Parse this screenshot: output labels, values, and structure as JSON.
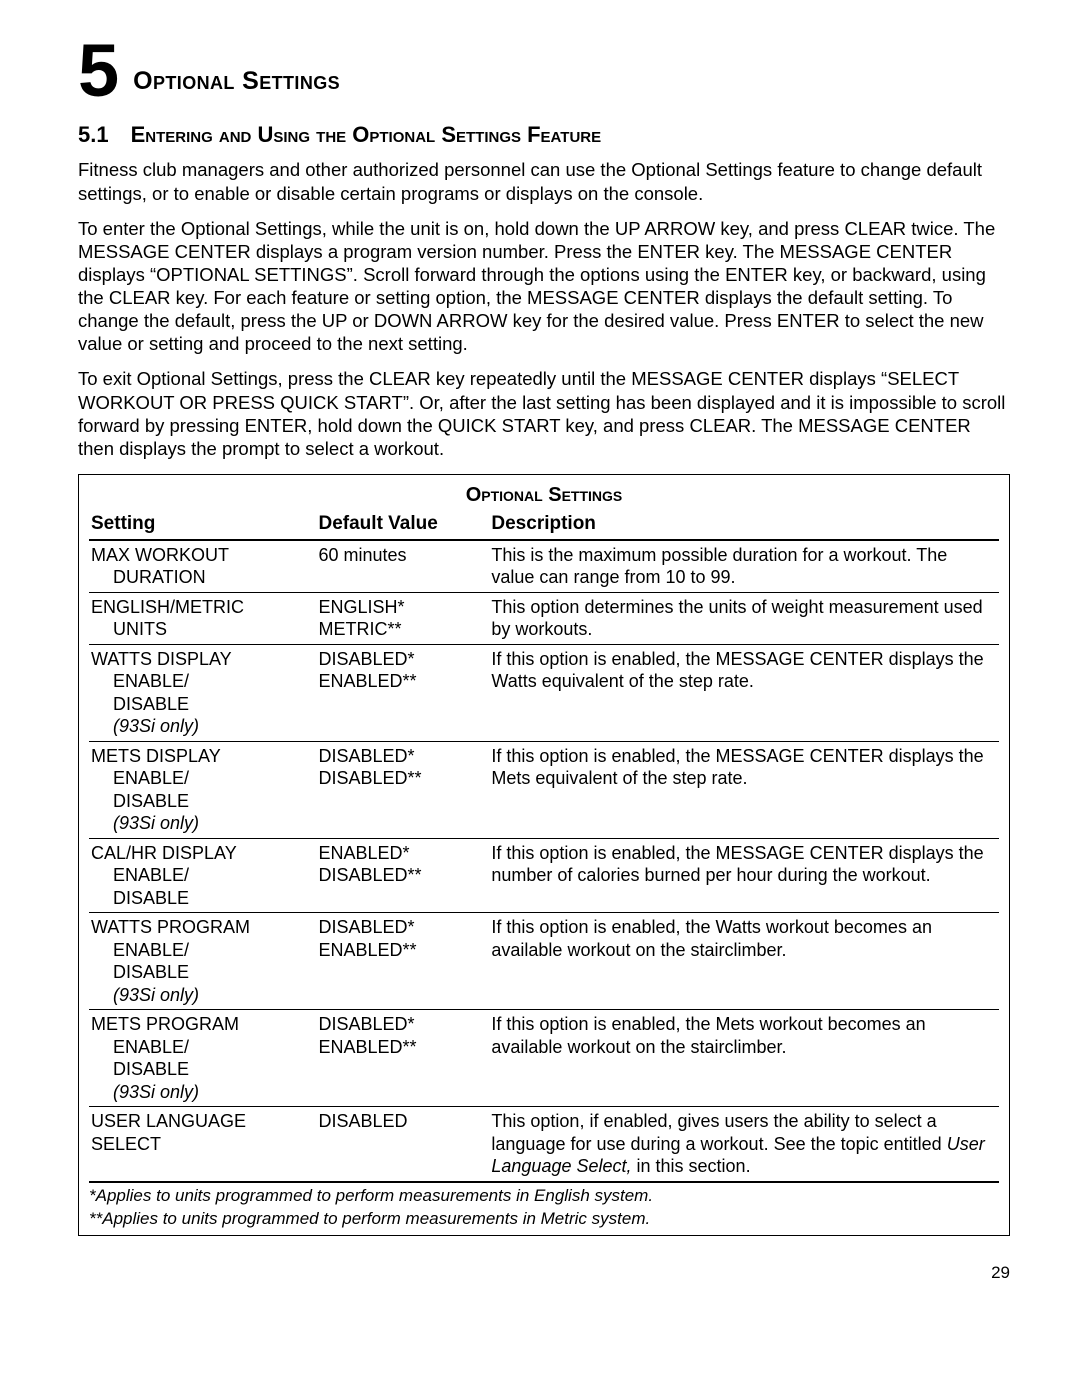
{
  "chapter": {
    "number": "5",
    "title": "Optional Settings"
  },
  "section": {
    "number": "5.1",
    "title": "Entering and Using the Optional Settings Feature"
  },
  "paragraphs": {
    "p1": "Fitness club managers and other authorized personnel can use the Optional Settings feature to change default settings, or to enable or disable certain programs or displays on the console.",
    "p2": "To enter the Optional Settings, while the unit is on, hold down the UP ARROW key, and press CLEAR twice. The MESSAGE CENTER displays a program version number. Press the ENTER key. The MESSAGE CENTER displays “OPTIONAL SETTINGS”. Scroll forward through the options using the ENTER key, or backward, using the CLEAR key. For each feature or setting option, the MESSAGE CENTER displays the default setting. To change the default, press the UP or DOWN ARROW key for the desired value. Press ENTER to select the new value or setting and proceed to the next setting.",
    "p3": "To exit Optional Settings, press the CLEAR key repeatedly until the MESSAGE CENTER displays “SELECT WORKOUT OR PRESS QUICK START”. Or, after the last setting has been displayed and it is impossible to scroll forward by pressing ENTER, hold down the QUICK START key, and press CLEAR. The MESSAGE CENTER then displays the prompt to select a workout."
  },
  "table": {
    "title": "Optional Settings",
    "headers": {
      "setting": "Setting",
      "default": "Default Value",
      "description": "Description"
    },
    "rows": [
      {
        "setting_main": "MAX WORKOUT",
        "setting_sub": "DURATION",
        "setting_note": "",
        "default_a": "60 minutes",
        "default_b": "",
        "description": "This is the maximum possible duration for a workout. The value can range from 10 to 99."
      },
      {
        "setting_main": "ENGLISH/METRIC",
        "setting_sub": "UNITS",
        "setting_note": "",
        "default_a": "ENGLISH*",
        "default_b": "METRIC**",
        "description": "This option determines the units of weight measurement used by workouts."
      },
      {
        "setting_main": "WATTS DISPLAY",
        "setting_sub": "ENABLE/\nDISABLE",
        "setting_note": "(93Si only)",
        "default_a": "DISABLED*",
        "default_b": "ENABLED**",
        "description": "If this option is enabled, the MESSAGE CENTER displays the Watts equivalent of the step rate."
      },
      {
        "setting_main": "METS DISPLAY",
        "setting_sub": "ENABLE/\nDISABLE",
        "setting_note": "(93Si only)",
        "default_a": "DISABLED*",
        "default_b": "DISABLED**",
        "description": "If this option is enabled, the MESSAGE CENTER displays the Mets equivalent of the step rate."
      },
      {
        "setting_main": "CAL/HR DISPLAY",
        "setting_sub": "ENABLE/\nDISABLE",
        "setting_note": "",
        "default_a": "ENABLED*",
        "default_b": "DISABLED**",
        "description": "If this option is enabled, the MESSAGE CENTER displays the number of calories burned per hour during the workout."
      },
      {
        "setting_main": "WATTS PROGRAM",
        "setting_sub": "ENABLE/\nDISABLE",
        "setting_note": "(93Si only)",
        "default_a": "DISABLED*",
        "default_b": "ENABLED**",
        "description": "If this option is enabled, the Watts workout becomes an available workout on the stairclimber."
      },
      {
        "setting_main": "METS PROGRAM",
        "setting_sub": "ENABLE/\nDISABLE",
        "setting_note": "(93Si only)",
        "default_a": "DISABLED*",
        "default_b": "ENABLED**",
        "description": "If this option is enabled, the Mets workout becomes an available workout on the stairclimber."
      },
      {
        "setting_main": "USER LANGUAGE SELECT",
        "setting_sub": "",
        "setting_note": "",
        "default_a": "DISABLED",
        "default_b": "",
        "description_pre": "This option, if enabled, gives users the ability to select a language for use during a workout. See the topic entitled ",
        "description_italic": "User Language Select,",
        "description_post": " in this section."
      }
    ],
    "footnote1": "*Applies to units programmed to perform measurements in English system.",
    "footnote2": "**Applies to units programmed to perform measurements in Metric system."
  },
  "page_number": "29"
}
